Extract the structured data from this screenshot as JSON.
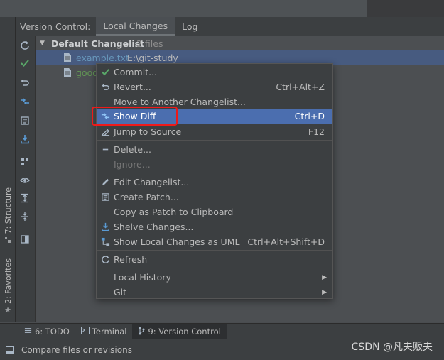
{
  "header": {
    "title": "Version Control:",
    "tabs": [
      {
        "label": "Local Changes"
      },
      {
        "label": "Log"
      }
    ]
  },
  "changelist": {
    "name": "Default Changelist",
    "count": "2 files",
    "files": [
      {
        "name": "example.txt",
        "path": "E:\\git-study"
      },
      {
        "name": "good"
      }
    ]
  },
  "context_menu": {
    "items": [
      {
        "label": "Commit...",
        "icon": "check-icon"
      },
      {
        "label": "Revert...",
        "shortcut": "Ctrl+Alt+Z",
        "icon": "undo-icon"
      },
      {
        "label": "Move to Another Changelist..."
      },
      {
        "label": "Show Diff",
        "shortcut": "Ctrl+D",
        "icon": "diff-icon"
      },
      {
        "label": "Jump to Source",
        "shortcut": "F12",
        "icon": "edit-source-icon"
      },
      {
        "label": "Delete...",
        "icon": "minus-icon"
      },
      {
        "label": "Ignore..."
      },
      {
        "label": "Edit Changelist...",
        "icon": "pencil-icon"
      },
      {
        "label": "Create Patch...",
        "icon": "patch-icon"
      },
      {
        "label": "Copy as Patch to Clipboard"
      },
      {
        "label": "Shelve Changes...",
        "icon": "shelve-icon"
      },
      {
        "label": "Show Local Changes as UML",
        "shortcut": "Ctrl+Alt+Shift+D",
        "icon": "uml-icon"
      },
      {
        "label": "Refresh",
        "icon": "refresh-icon"
      },
      {
        "label": "Local History"
      },
      {
        "label": "Git"
      }
    ]
  },
  "left_tabs": {
    "structure": "7: Structure",
    "favorites": "2: Favorites"
  },
  "bottom_tabs": [
    {
      "label": "6: TODO"
    },
    {
      "label": "Terminal"
    },
    {
      "label": "9: Version Control"
    }
  ],
  "status": {
    "text": "Compare files or revisions"
  },
  "watermark": "CSDN @凡夫贩夫",
  "colors": {
    "selection": "#475b80",
    "menu_highlight": "#4b6eaf",
    "annotation_box": "#ee1a1a",
    "accent_blue": "#5a9bd5",
    "green_file": "#629755"
  }
}
